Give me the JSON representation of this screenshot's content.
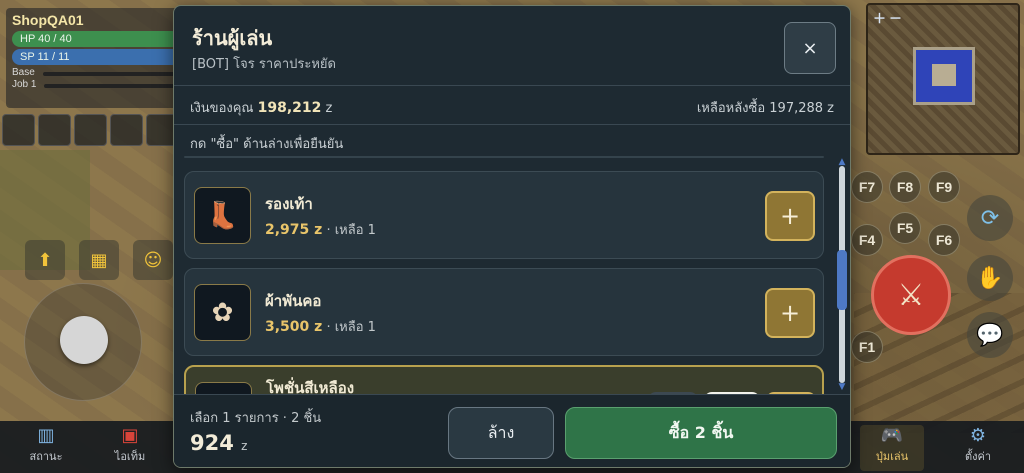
{
  "player": {
    "name": "ShopQA01",
    "hp": "HP 40 / 40",
    "sp": "SP 11 / 11",
    "base_label": "Base",
    "job_label": "Job 1"
  },
  "bottom_nav": [
    {
      "label": "สถานะ",
      "icon": "chart-icon"
    },
    {
      "label": "ไอเท็ม",
      "icon": "bag-icon"
    },
    {
      "label": "ปุ่มเล่น",
      "icon": "gamepad-icon"
    },
    {
      "label": "ตั้งค่า",
      "icon": "gear-icon"
    }
  ],
  "fkeys": [
    "F7",
    "F8",
    "F9",
    "F4",
    "F5",
    "F6",
    "F1"
  ],
  "shop": {
    "title": "ร้านผู้เล่น",
    "subtitle": "[BOT] โจร ราคาประหยัด",
    "close_label": "×",
    "money_label": "เงินของคุณ",
    "money_value": "198,212",
    "money_unit": "z",
    "remaining": "เหลือหลังซื้อ 197,288 z",
    "hint": "กด \"ซื้อ\" ด้านล่างเพื่อยืนยัน",
    "items": [
      {
        "name": "รองเท้า",
        "price": "2,975 z",
        "stock": "· เหลือ 1",
        "icon": "boots-icon",
        "add_label": "+"
      },
      {
        "name": "ผ้าพันคอ",
        "price": "3,500 z",
        "stock": "· เหลือ 1",
        "icon": "muffler-icon",
        "add_label": "+"
      },
      {
        "name": "โพชั่นสีเหลือง",
        "icon": "yellow-potion-icon",
        "selected": true
      }
    ],
    "summary": "เลือก 1 รายการ · 2 ชิ้น",
    "total_value": "924",
    "total_unit": "z",
    "clear_label": "ล้าง",
    "buy_label": "ซื้อ 2 ชิ้น"
  },
  "colors": {
    "accent_gold": "#d3b35c",
    "buy_green": "#2f7448",
    "hp_green": "#3d8f4e",
    "sp_blue": "#3b6fae"
  }
}
